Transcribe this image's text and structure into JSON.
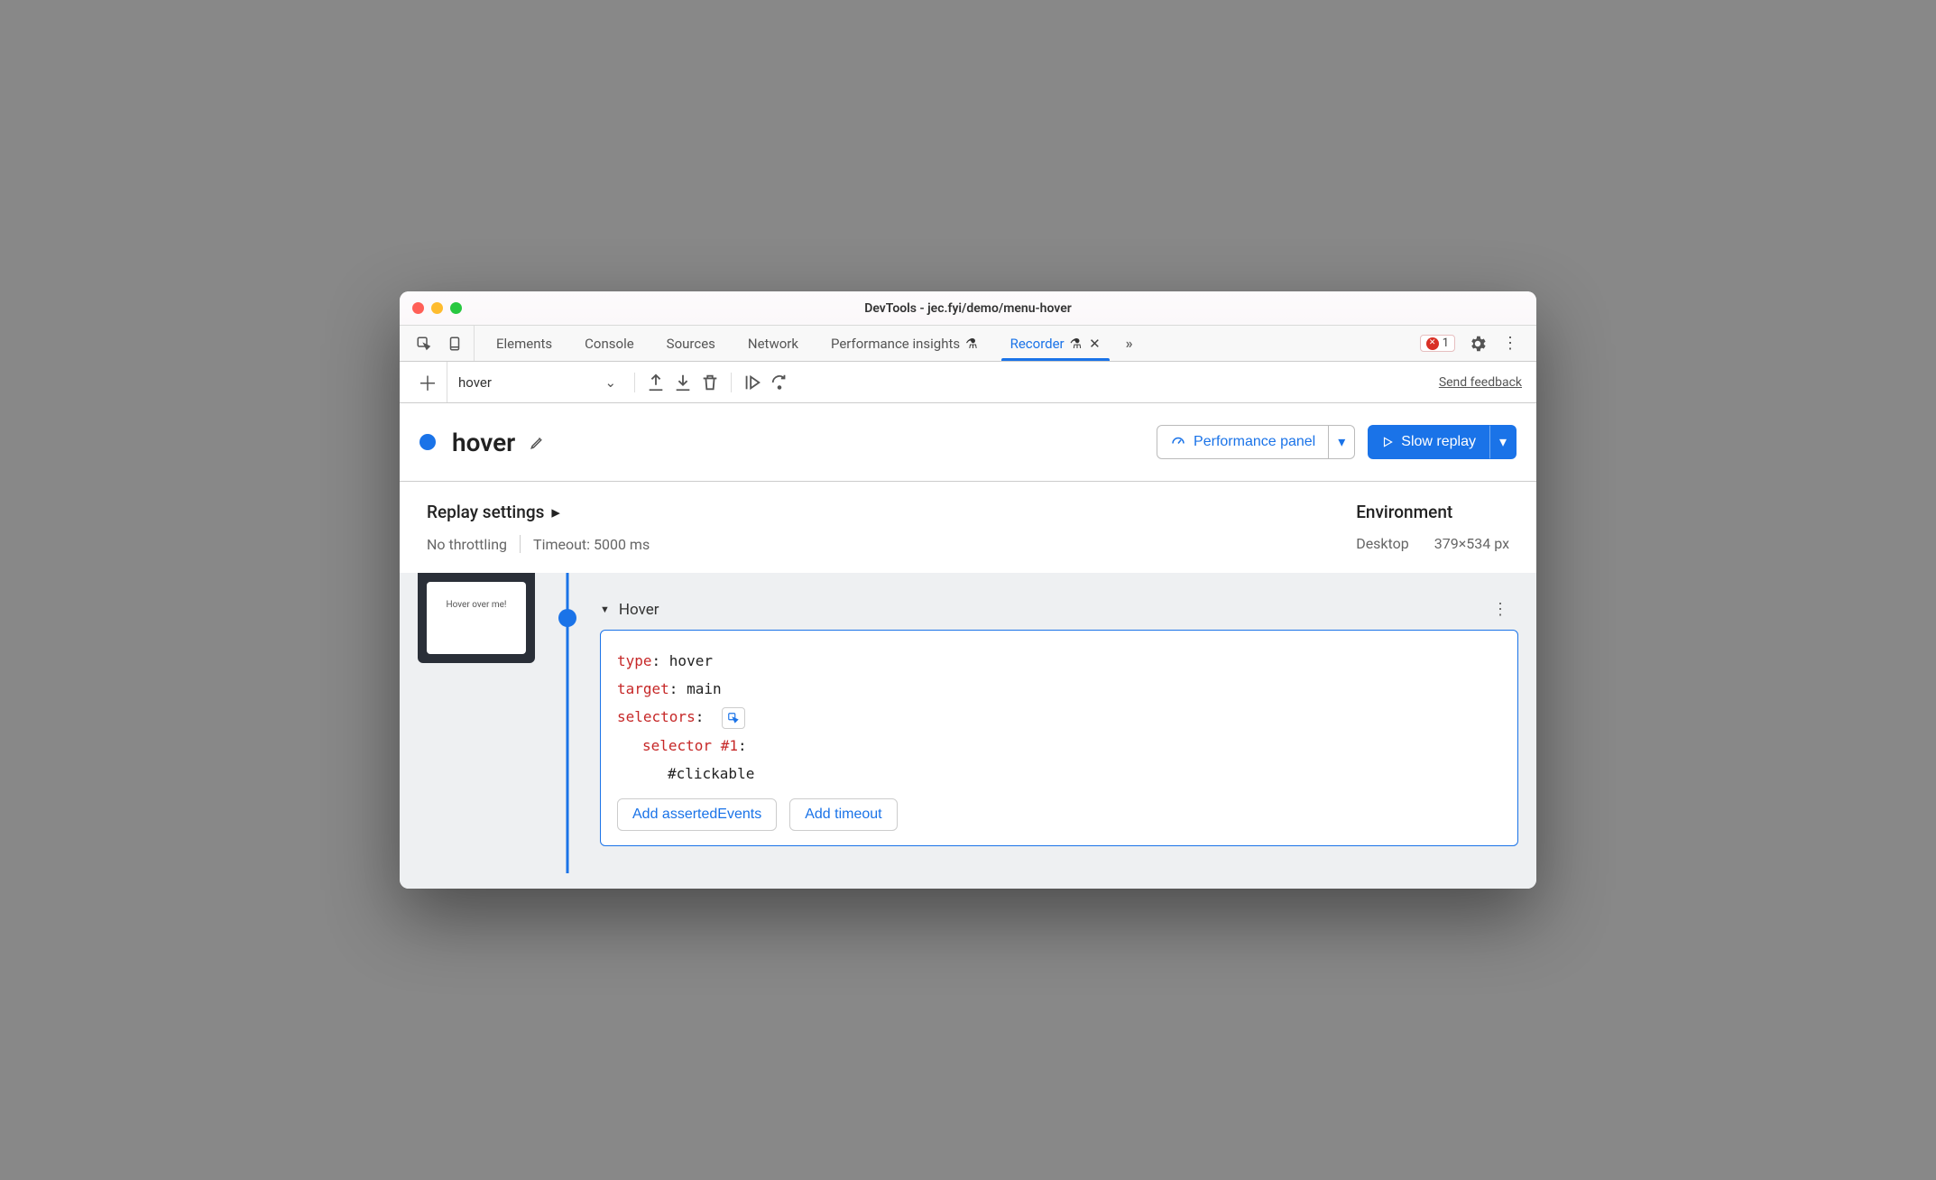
{
  "window": {
    "title": "DevTools - jec.fyi/demo/menu-hover"
  },
  "tabs": {
    "items": [
      {
        "label": "Elements",
        "active": false
      },
      {
        "label": "Console",
        "active": false
      },
      {
        "label": "Sources",
        "active": false
      },
      {
        "label": "Network",
        "active": false
      },
      {
        "label": "Performance insights",
        "active": false,
        "experiment": true
      },
      {
        "label": "Recorder",
        "active": true,
        "experiment": true,
        "closable": true
      }
    ],
    "error_count": "1"
  },
  "toolbar": {
    "recording_select": "hover",
    "feedback": "Send feedback"
  },
  "header": {
    "recording_name": "hover",
    "perf_button": "Performance panel",
    "replay_button": "Slow replay"
  },
  "settings": {
    "replay_title": "Replay settings",
    "throttling": "No throttling",
    "timeout": "Timeout: 5000 ms",
    "env_title": "Environment",
    "env_device": "Desktop",
    "env_size": "379×534 px"
  },
  "thumb": {
    "caption": "Hover over me!"
  },
  "step": {
    "title": "Hover",
    "type_key": "type",
    "type_val": "hover",
    "target_key": "target",
    "target_val": "main",
    "selectors_key": "selectors",
    "selector_label": "selector #1",
    "selector_value": "#clickable",
    "add_asserted": "Add assertedEvents",
    "add_timeout": "Add timeout"
  }
}
